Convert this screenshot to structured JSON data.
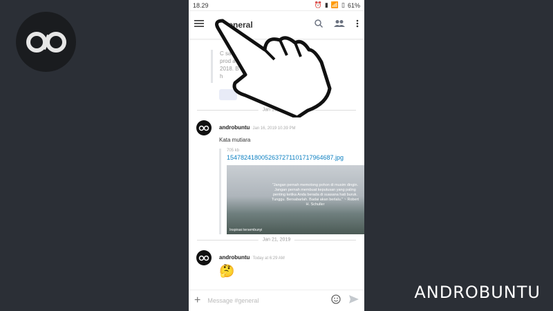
{
  "statusbar": {
    "time": "18.29",
    "battery": "61%"
  },
  "appbar": {
    "channel": "# general"
  },
  "chat": {
    "prev_message_lines": [
      "C                                    satu",
      "prod                                    a",
      "2018. B",
      "h"
    ],
    "date1": "Jan 16, 2019",
    "message1": {
      "author": "androbuntu",
      "timestamp": "Jan 16, 2019 10.39 PM",
      "text": "Kata mutiara",
      "file_size": "705 kb",
      "file_name": "1547824180052637271101717964687.jpg",
      "image_quote": "\"Jangan pernah memotong pohon di musim dingin. Jangan pernah membuat keputusan yang paling penting ketika Anda berada di suasana hati buruk. Tunggu. Bersabarlah. Badai akan berlalu.\" ~ Robert H. Schuller",
      "image_credit": "Inspirasi tersembunyi"
    },
    "date2": "Jan 21, 2019",
    "message2": {
      "author": "androbuntu",
      "timestamp": "Today at 6:29 AM",
      "emoji": "🤔"
    }
  },
  "composer": {
    "placeholder": "Message #general"
  },
  "brand": {
    "name": "ANDROBUNTU"
  },
  "colors": {
    "link": "#0b7fc1",
    "background": "#2b2f36"
  }
}
